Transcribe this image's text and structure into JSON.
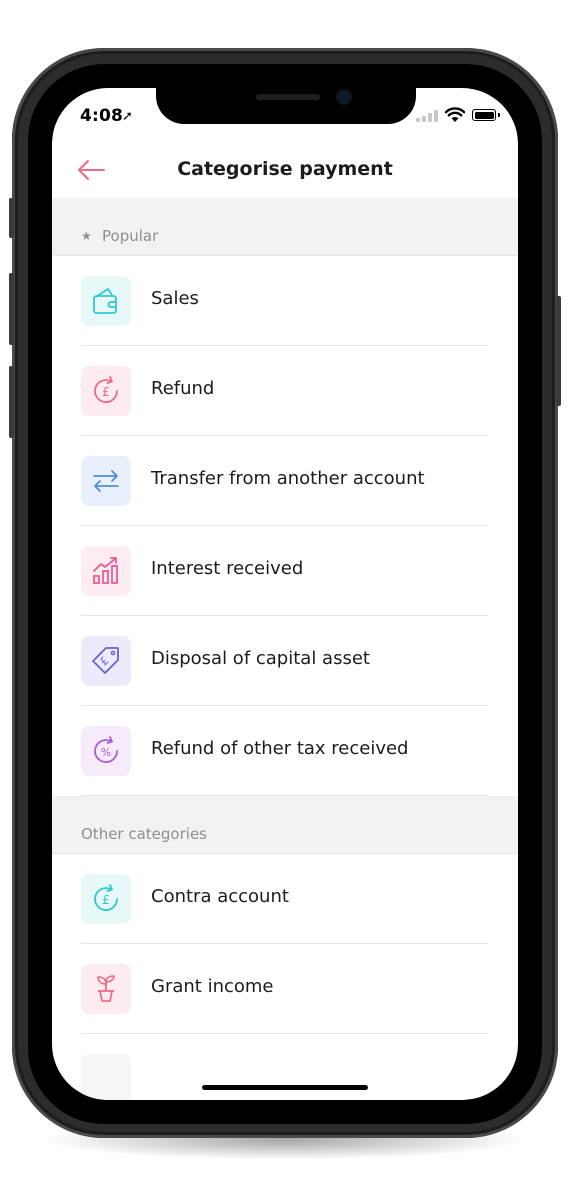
{
  "status_bar": {
    "time": "4:08",
    "location_glyph": "➚"
  },
  "header": {
    "title": "Categorise payment",
    "back_icon": "back-arrow-icon"
  },
  "popular": {
    "star_glyph": "★",
    "label": "Popular",
    "items": [
      {
        "label": "Sales",
        "icon": "wallet-icon",
        "bg": "#e6f8f8",
        "color": "#2cc9cf"
      },
      {
        "label": "Refund",
        "icon": "pound-refund-icon",
        "bg": "#fdecef",
        "color": "#f06a86"
      },
      {
        "label": "Transfer from another account",
        "icon": "transfer-arrows-icon",
        "bg": "#e9f0fb",
        "color": "#4a8fdc"
      },
      {
        "label": "Interest received",
        "icon": "growth-chart-icon",
        "bg": "#fdecf2",
        "color": "#ef5c95"
      },
      {
        "label": "Disposal of capital asset",
        "icon": "pound-tag-icon",
        "bg": "#ecebfb",
        "color": "#6b62d8"
      },
      {
        "label": "Refund of other tax received",
        "icon": "percent-refund-icon",
        "bg": "#f6ebfb",
        "color": "#b05ad8"
      }
    ]
  },
  "other": {
    "label": "Other categories",
    "items": [
      {
        "label": "Contra account",
        "icon": "pound-cycle-icon",
        "bg": "#e6f8f8",
        "color": "#2cc9cf"
      },
      {
        "label": "Grant income",
        "icon": "plant-pot-icon",
        "bg": "#fdecef",
        "color": "#f06a86"
      }
    ]
  },
  "colors": {
    "accent": "#f06a86",
    "section_bg": "#f2f2f3",
    "divider": "#e4e4e6"
  }
}
